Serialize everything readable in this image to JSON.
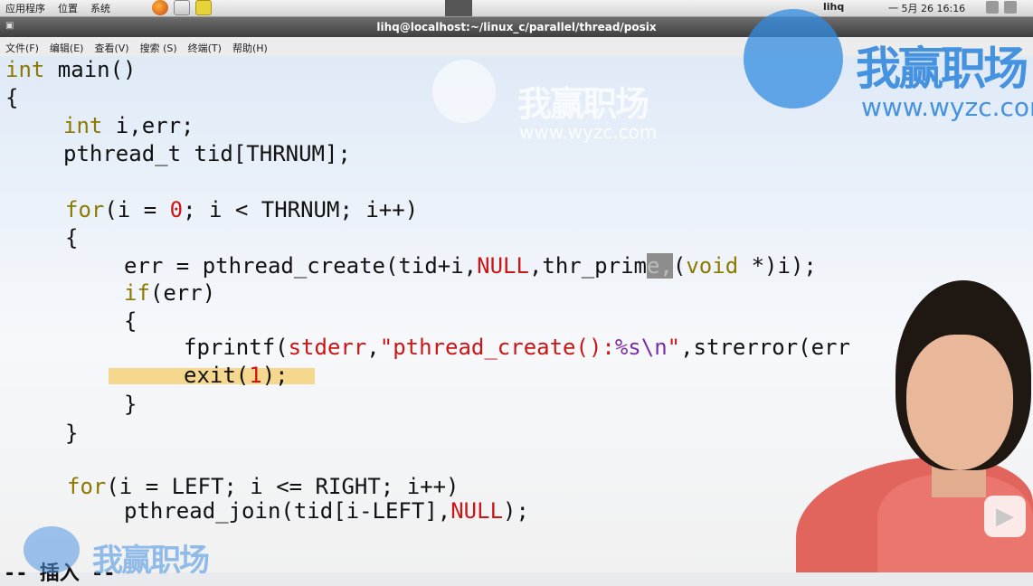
{
  "panel": {
    "menus": [
      "应用程序",
      "位置",
      "系统"
    ],
    "user": "lihq",
    "clock": "一 5月 26 16:16"
  },
  "window": {
    "title": "lihq@localhost:~/linux_c/parallel/thread/posix",
    "menu": [
      "文件(F)",
      "编辑(E)",
      "查看(V)",
      "搜索 (S)",
      "终端(T)",
      "帮助(H)"
    ]
  },
  "code": {
    "l1_kw": "int",
    "l1_rest": " main()",
    "l2": "{",
    "l3_kw": "int",
    "l3_rest": " i,err;",
    "l4": "pthread_t tid[THRNUM];",
    "l5_kw": "for",
    "l5_a": "(i = ",
    "l5_num": "0",
    "l5_b": "; i < THRNUM; i++)",
    "l6": "{",
    "l7_a": "err = pthread_create(tid+i,",
    "l7_null": "NULL",
    "l7_b": ",thr_prim",
    "l7_cur": "e,",
    "l7_c": "(",
    "l7_void": "void",
    "l7_d": " *)i);",
    "l8_kw": "if",
    "l8_rest": "(err)",
    "l9": "{",
    "l10_a": "fprintf(",
    "l10_stderr": "stderr",
    "l10_b": ",",
    "l10_str": "\"pthread_create():",
    "l10_fmt": "%s\\n",
    "l10_str2": "\"",
    "l10_c": ",strerror(err",
    "l11_a": "exit(",
    "l11_num": "1",
    "l11_b": ");",
    "l12": "}",
    "l13": "}",
    "l14_kw": "for",
    "l14_rest": "(i = LEFT; i <= RIGHT; i++)",
    "l15_a": "pthread_join(tid[i-LEFT],",
    "l15_null": "NULL",
    "l15_b": ");",
    "status": "-- 插入 --"
  },
  "watermark": {
    "brand": "我赢职场",
    "url": "www.wyzc.com"
  }
}
